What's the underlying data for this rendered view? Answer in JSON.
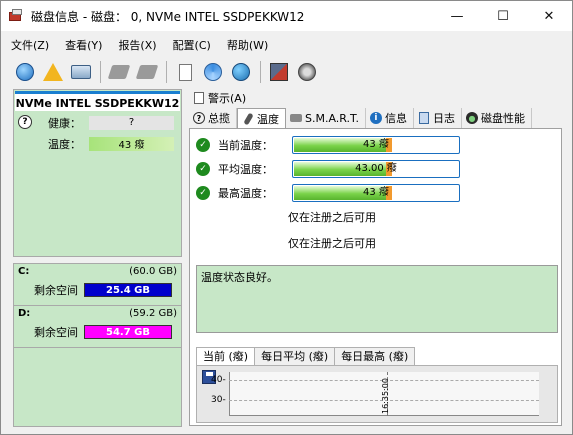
{
  "window": {
    "title": "磁盘信息 - 磁盘： 0, NVMe    INTEL SSDPEKKW12",
    "minimize": "—",
    "maximize": "☐",
    "close": "✕"
  },
  "menu": [
    "文件(Z)",
    "查看(Y)",
    "报告(X)",
    "配置(C)",
    "帮助(W)"
  ],
  "toolbar_icons": [
    "refresh-icon",
    "warning-icon",
    "disk-icon",
    "tool-icon",
    "tool2-icon",
    "document-icon",
    "sync-icon",
    "globe-icon",
    "chart-icon",
    "speaker-icon"
  ],
  "left": {
    "disk_name": "NVMe    INTEL SSDPEKKW12",
    "health_label": "健康：",
    "health_value": "?",
    "temp_label": "温度：",
    "temp_value": "43 癈",
    "drives": [
      {
        "letter": "C:",
        "size": "(60.0 GB)",
        "free_label": "剩余空间",
        "free_value": "25.4 GB",
        "color": "#0000cc"
      },
      {
        "letter": "D:",
        "size": "(59.2 GB)",
        "free_label": "剩余空间",
        "free_value": "54.7 GB",
        "color": "#ff00ff"
      }
    ]
  },
  "right": {
    "alarm_tab": "警示(A)",
    "tabs": [
      "总揽",
      "温度",
      "S.M.A.R.T.",
      "信息",
      "日志",
      "磁盘性能"
    ],
    "temps": [
      {
        "label": "当前温度：",
        "value": "43 癈",
        "fill": 0.56
      },
      {
        "label": "平均温度：",
        "value": "43.00 癈",
        "fill": 0.56
      },
      {
        "label": "最高温度：",
        "value": "43 癈",
        "fill": 0.56
      }
    ],
    "note1": "仅在注册之后可用",
    "note2": "仅在注册之后可用",
    "status_text": "温度状态良好。",
    "history_tabs": [
      "当前 (癈)",
      "每日平均 (癈)",
      "每日最高 (癈)"
    ],
    "graph": {
      "y_ticks": [
        "40-",
        "30-"
      ],
      "time_label": "16:35:00"
    }
  },
  "colors": {
    "panel_green": "#c7e7c7",
    "accent_blue": "#1a7fd0",
    "bar_green": "#7ad34a"
  }
}
